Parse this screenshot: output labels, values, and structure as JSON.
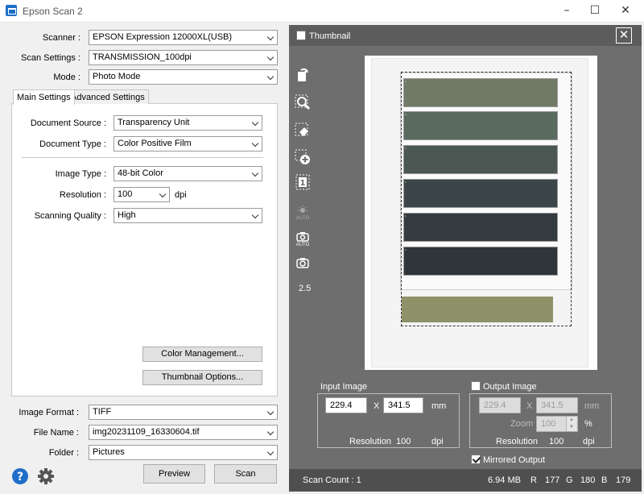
{
  "window": {
    "title": "Epson Scan 2"
  },
  "left": {
    "scanner": {
      "label": "Scanner :",
      "value": "EPSON Expression 12000XL(USB)"
    },
    "scan_settings": {
      "label": "Scan Settings :",
      "value": "TRANSMISSION_100dpi"
    },
    "mode": {
      "label": "Mode :",
      "value": "Photo Mode"
    },
    "tabs": [
      {
        "label": "Main Settings"
      },
      {
        "label": "Advanced Settings"
      }
    ],
    "document_source": {
      "label": "Document Source :",
      "value": "Transparency Unit"
    },
    "document_type": {
      "label": "Document Type :",
      "value": "Color Positive Film"
    },
    "image_type": {
      "label": "Image Type :",
      "value": "48-bit Color"
    },
    "resolution": {
      "label": "Resolution :",
      "value": "100",
      "unit": "dpi"
    },
    "scanning_quality": {
      "label": "Scanning Quality :",
      "value": "High"
    },
    "color_management_label": "Color Management...",
    "thumbnail_options_label": "Thumbnail Options...",
    "image_format": {
      "label": "Image Format :",
      "value": "TIFF"
    },
    "file_name": {
      "label": "File Name :",
      "value": "img20231109_16330604.tif"
    },
    "folder": {
      "label": "Folder :",
      "value": "Pictures"
    },
    "preview_label": "Preview",
    "scan_label": "Scan"
  },
  "right": {
    "thumbnail_label": "Thumbnail",
    "tools": {
      "rotate": "rotate-icon",
      "zoom": "zoom-icon",
      "erase": "eraser-icon",
      "add": "add-marquee-icon",
      "count": "1",
      "auto_exposure": "AUTO",
      "camera_auto": "AUTO",
      "zoom_value": "2.5"
    },
    "input_image": {
      "title": "Input Image",
      "width": "229.4",
      "height": "341.5",
      "x": "X",
      "unit": "mm",
      "resolution_label": "Resolution",
      "resolution_value": "100",
      "resolution_unit": "dpi"
    },
    "output_image": {
      "title": "Output Image",
      "width": "229.4",
      "height": "341.5",
      "x": "X",
      "unit": "mm",
      "zoom_label": "Zoom",
      "zoom_value": "100",
      "zoom_unit": "%",
      "resolution_label": "Resolution",
      "resolution_value": "100",
      "resolution_unit": "dpi"
    },
    "mirrored_output": "Mirrored Output",
    "status": {
      "scan_count": "Scan Count : 1",
      "size": "6.94 MB",
      "r_label": "R",
      "r": "177",
      "g_label": "G",
      "g": "180",
      "b_label": "B",
      "b": "179"
    }
  },
  "colors": {
    "panel_bg": "#6e6e6e",
    "help_blue": "#1e6fc8"
  },
  "film_frames": [
    {
      "color": "#6f7b66"
    },
    {
      "color": "#5a6a5f"
    },
    {
      "color": "#4a5753"
    },
    {
      "color": "#3c4648"
    },
    {
      "color": "#343c41"
    },
    {
      "color": "#2f363b"
    }
  ]
}
